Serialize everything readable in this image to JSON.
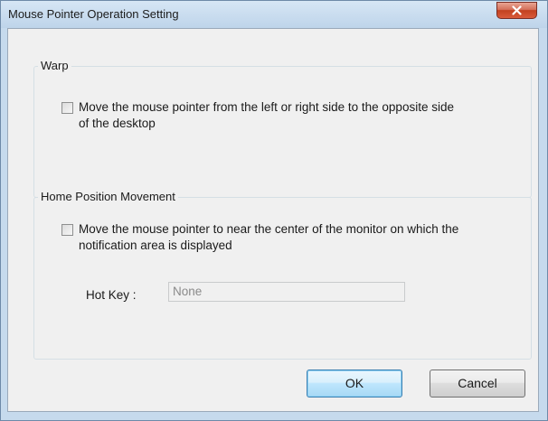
{
  "window": {
    "title": "Mouse Pointer Operation Setting",
    "close_icon": "close-icon"
  },
  "warp": {
    "legend": "Warp",
    "checkbox_checked": false,
    "checkbox_label": "Move the mouse pointer from the left or right side to the opposite side of the desktop"
  },
  "home": {
    "legend": "Home Position Movement",
    "checkbox_checked": false,
    "checkbox_label": "Move the mouse pointer to near the center of the monitor on which the notification area is displayed",
    "hotkey_label": "Hot Key :",
    "hotkey_value": "None"
  },
  "buttons": {
    "ok_label": "OK",
    "cancel_label": "Cancel"
  },
  "colors": {
    "client_background": "#f0f0f0",
    "frame": "#c6daed",
    "close_button": "#c2411f"
  }
}
